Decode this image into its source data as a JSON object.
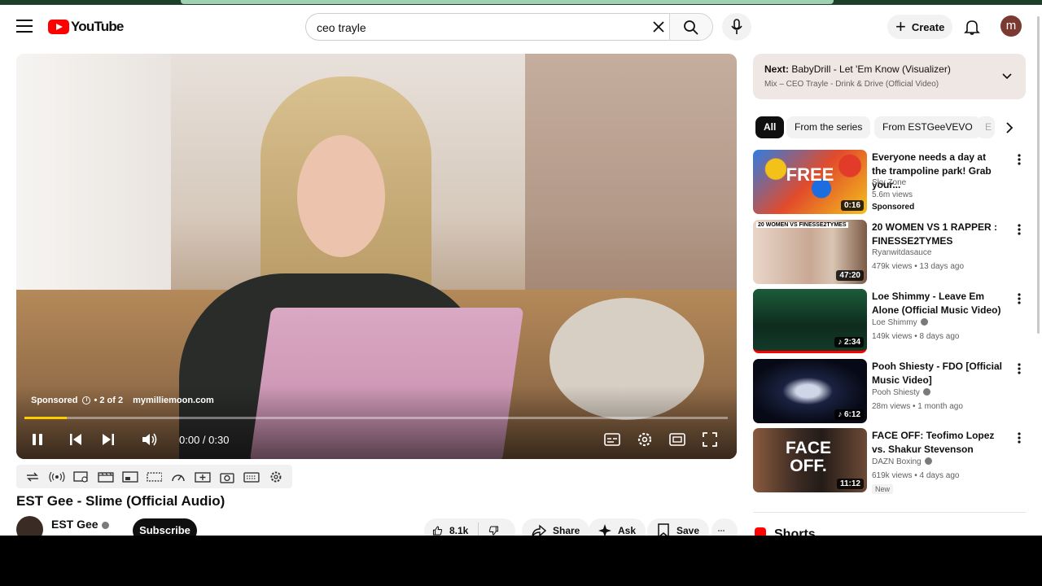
{
  "masthead": {
    "logo_text": "YouTube",
    "search_value": "ceo trayle",
    "create_label": "Create",
    "avatar_letter": "m"
  },
  "player": {
    "ad_label": "Sponsored",
    "ad_count": "• 2 of 2",
    "ad_site": "mymilliemoon.com",
    "time": "0:00 / 0:30",
    "progress_fraction": 0.06,
    "accent_color": "#ffcc00"
  },
  "video": {
    "title": "EST Gee - Slime (Official Audio)",
    "channel": "EST Gee",
    "subscribe_label": "Subscribe",
    "likes": "8.1k",
    "share_label": "Share",
    "ask_label": "Ask",
    "save_label": "Save"
  },
  "next_up": {
    "prefix": "Next:",
    "title": "BabyDrill - Let 'Em Know (Visualizer)",
    "mix": "Mix – CEO Trayle - Drink & Drive (Official Video)"
  },
  "chips": [
    "All",
    "From the series",
    "From ESTGeeVEVO",
    "E"
  ],
  "recommendations": [
    {
      "title": "Everyone needs a day at the trampoline park! Grab your...",
      "channel": "Sky Zone",
      "meta": "5.6m views",
      "tag": "Sponsored",
      "duration": "0:16",
      "thumb_text": "FREE"
    },
    {
      "title": "20 WOMEN VS 1 RAPPER : FINESSE2TYMES",
      "channel": "Ryanwitdasauce",
      "meta": "479k views • 13 days ago",
      "duration": "47:20",
      "thumb_text": "20 WOMEN VS FINESSE2TYMES"
    },
    {
      "title": "Loe Shimmy - Leave Em Alone (Official Music Video)",
      "channel": "Loe Shimmy",
      "meta": "149k views • 8 days ago",
      "duration": "2:34"
    },
    {
      "title": "Pooh Shiesty - FDO [Official Music Video]",
      "channel": "Pooh Shiesty",
      "meta": "28m views • 1 month ago",
      "duration": "6:12"
    },
    {
      "title": "FACE OFF: Teofimo Lopez vs. Shakur Stevenson",
      "channel": "DAZN Boxing",
      "meta": "619k views • 4 days ago",
      "tag": "New",
      "duration": "11:12",
      "thumb_text": "FACE OFF."
    }
  ],
  "shorts_label": "Shorts",
  "icons": [
    "menu-icon",
    "search-icon",
    "clear-icon",
    "mic-icon",
    "bell-icon",
    "pause-icon",
    "previous-icon",
    "next-icon",
    "volume-icon",
    "captions-icon",
    "settings-icon",
    "theater-icon",
    "fullscreen-icon",
    "like-icon",
    "dislike-icon",
    "share-icon",
    "ask-icon",
    "save-icon",
    "more-icon",
    "chevron-down-icon",
    "chevron-right-icon"
  ]
}
